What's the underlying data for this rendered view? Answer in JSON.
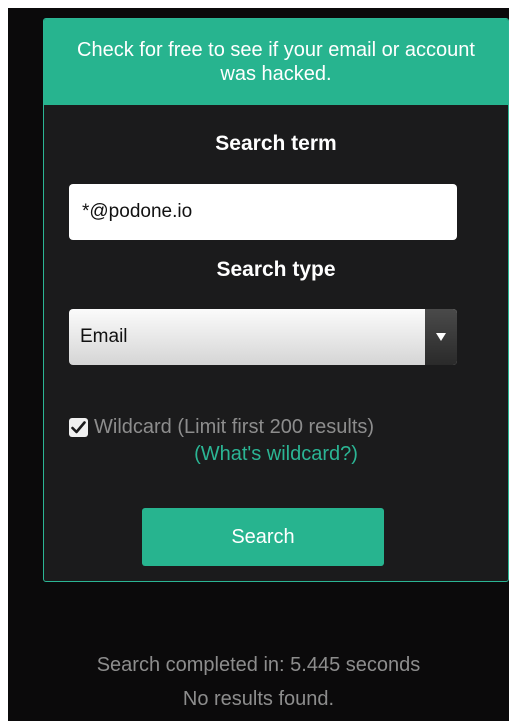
{
  "header": {
    "message": "Check for free to see if your email or account was hacked."
  },
  "form": {
    "search_term_label": "Search term",
    "search_term_value": "*@podone.io",
    "search_type_label": "Search type",
    "search_type_selected": "Email",
    "wildcard_checked": true,
    "wildcard_label": "Wildcard (Limit first 200 results)",
    "wildcard_help_link": "(What's wildcard?)",
    "search_button": "Search"
  },
  "results": {
    "completed_text": "Search completed in: 5.445 seconds",
    "status_text": "No results found."
  },
  "colors": {
    "accent": "#27b48f",
    "card_background": "#1b1b1c",
    "page_background": "#0b0a0b",
    "muted_text": "#8d8d8d"
  },
  "icons": {
    "dropdown": "caret-down-icon",
    "checkbox": "checkmark-icon"
  }
}
